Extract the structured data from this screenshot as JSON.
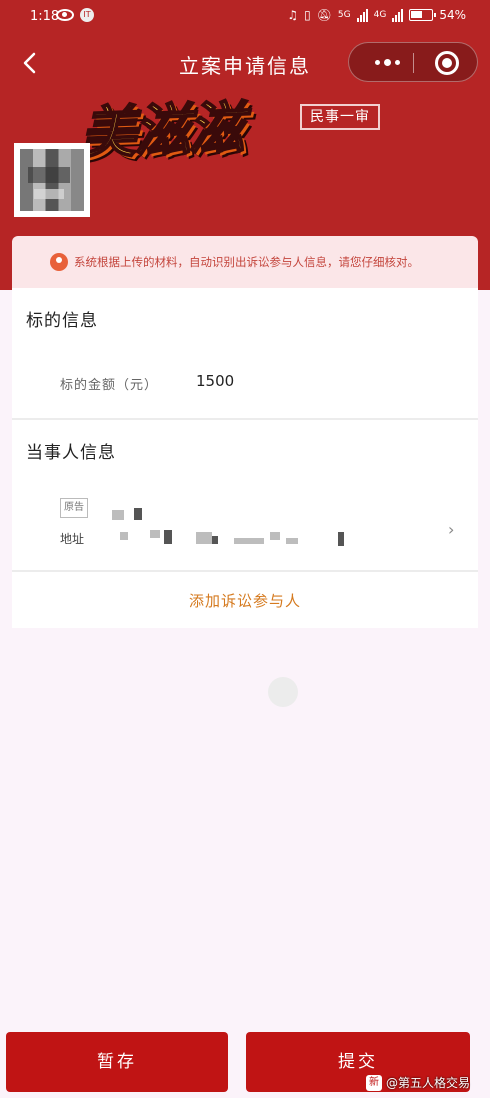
{
  "status_bar": {
    "time": "1:18",
    "app_badge": "IT",
    "net1": "5G",
    "net2": "4G",
    "battery": "54%"
  },
  "navbar": {
    "title": "立案申请信息"
  },
  "header": {
    "brand_overlay": "美滋滋",
    "case_type": "民事一审"
  },
  "notice": {
    "text": "系统根据上传的材料，自动识别出诉讼参与人信息，请您仔细核对。"
  },
  "subject": {
    "title": "标的信息",
    "amount_label": "标的金额（元）",
    "amount_value": "1500"
  },
  "parties": {
    "title": "当事人信息",
    "role_tag": "原告",
    "address_label": "地址"
  },
  "actions": {
    "add_party": "添加诉讼参与人",
    "save": "暂存",
    "submit": "提交"
  },
  "watermark": {
    "icon": "新",
    "text": "@第五人格交易"
  },
  "colors": {
    "header_red": "#b62525",
    "button_red": "#c01414",
    "notice_text": "#c4463d",
    "add_party_orange": "#d57a1f"
  }
}
